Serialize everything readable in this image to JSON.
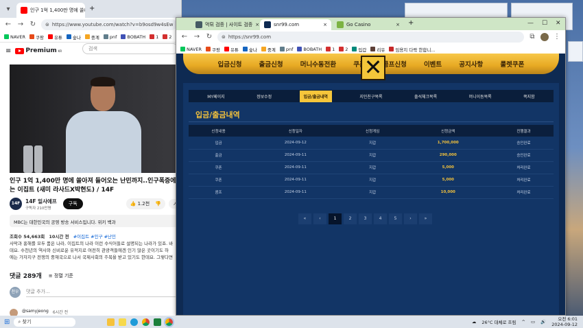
{
  "left_browser": {
    "tab_title": "인구 1억 1,400만 명에 쏠리",
    "new_tab": "+",
    "url": "https://www.youtube.com/watch?v=b9osd9w4sEw",
    "bookmarks": [
      {
        "label": "NAVER",
        "color": "#03c75a"
      },
      {
        "label": "쿠팡",
        "color": "#e64a19"
      },
      {
        "label": "유튜",
        "color": "#ff0000"
      },
      {
        "label": "숲나",
        "color": "#1565c0"
      },
      {
        "label": "중계",
        "color": "#f5a623"
      },
      {
        "label": "pnf",
        "color": "#607d8b"
      },
      {
        "label": "BOBATH",
        "color": "#3f51b5"
      },
      {
        "label": "1",
        "color": "#d32f2f"
      },
      {
        "label": "2",
        "color": "#d32f2f"
      }
    ],
    "youtube": {
      "logo_text": "Premium",
      "logo_sup": "KR",
      "search_placeholder": "검색",
      "title_line1": "인구 1억 1,400만 명에 쏠아져 들어오는 난민까지..인구폭증에",
      "title_line2": "는 이집트 (새미 라사드X박현도) / 14F",
      "channel_name": "14F 일사에프",
      "channel_avatar": "14F",
      "subscribers": "구독자 210만명",
      "subscribe_label": "구독",
      "likes": "1.2천",
      "mbc_notice": "MBC는 대한민국의 공영 방송 서비스입니다. 위키 백과",
      "views": "조회수 54,663회",
      "posted": "10시간 전",
      "tags": "#이집트 #인구 #난민",
      "desc_line1": "사막과 홍해를 모두 품은 나라, 이집트의 나라 이런 수식어들로 설명되는 나라가 있죠. 바",
      "desc_line2": "데요. 수천년의 역사와 신비로운 유적지로 여전히 관광객들에겐 인기 많은 곳이기도 하",
      "desc_line3": "에는 가자지구 전쟁의 중재국으로 나서 국제사회의 주목을 받고 있기도 한데요. 그렇다면",
      "comments_count": "댓글 289개",
      "sort_label": "정렬 기준",
      "comment_placeholder": "댓글 추가...",
      "my_avatar": "천우",
      "commenter": "@samyjeong",
      "comment_time": "6시간 전"
    }
  },
  "right_browser": {
    "tabs": [
      {
        "label": "먹튀 검증 | 사이트 검증",
        "active": false
      },
      {
        "label": "snr99.com",
        "active": true
      },
      {
        "label": "Go Casino",
        "active": false
      }
    ],
    "new_tab": "+",
    "url": "https://snr99.com",
    "bookmarks": [
      {
        "label": "NAVER",
        "color": "#03c75a"
      },
      {
        "label": "쿠팡",
        "color": "#e64a19"
      },
      {
        "label": "유튜",
        "color": "#ff0000"
      },
      {
        "label": "숲나",
        "color": "#1565c0"
      },
      {
        "label": "중계",
        "color": "#f5a623"
      },
      {
        "label": "pnf",
        "color": "#607d8b"
      },
      {
        "label": "BOBATH",
        "color": "#3f51b5"
      },
      {
        "label": "1",
        "color": "#d32f2f"
      },
      {
        "label": "2",
        "color": "#d32f2f"
      },
      {
        "label": "입갑",
        "color": "#00897b"
      },
      {
        "label": "리유",
        "color": "#5d4037"
      },
      {
        "label": "임용지 다락 한합니...",
        "color": "#c62828"
      }
    ],
    "site": {
      "main_nav": [
        "입금신청",
        "출금신청",
        "머니수동전환",
        "쿠폰",
        "콤프신청",
        "이벤트",
        "공지사항",
        "룰렛쿠폰"
      ],
      "close_glyph": "✕",
      "sub_nav": [
        "MY페이지",
        "정보수정",
        "입금/출금내역",
        "지인친구목록",
        "출석체크목록",
        "머니이동목록",
        "쪽지함"
      ],
      "sub_nav_active": 2,
      "section_title": "입금/출금내역",
      "table_headers": [
        "신청내용",
        "신청일자",
        "신청게임",
        "신청금액",
        "진행결과"
      ],
      "rows": [
        [
          "입금",
          "2024-09-12",
          "지갑",
          "1,700,000",
          "승인완료"
        ],
        [
          "출금",
          "2024-09-11",
          "지갑",
          "290,000",
          "승인완료"
        ],
        [
          "쿠폰",
          "2024-09-11",
          "지갑",
          "5,000",
          "처리완료"
        ],
        [
          "쿠폰",
          "2024-09-11",
          "지갑",
          "5,000",
          "처리완료"
        ],
        [
          "콤프",
          "2024-09-11",
          "지갑",
          "10,000",
          "처리완료"
        ]
      ],
      "pager": [
        "«",
        "‹",
        "1",
        "2",
        "3",
        "4",
        "5",
        "›",
        "»"
      ],
      "pager_active": 2
    }
  },
  "taskbar": {
    "search_label": "찾기",
    "weather": "26°C 대체로 흐림",
    "time": "오전 6:01",
    "date": "2024-09-12"
  }
}
